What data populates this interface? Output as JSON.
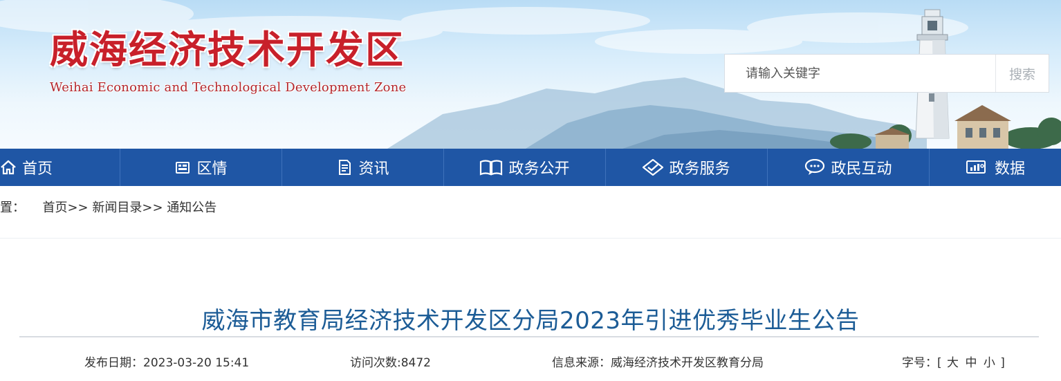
{
  "header": {
    "site_title": "威海经济技术开发区",
    "site_subtitle": "Weihai Economic and Technological Development Zone",
    "search_placeholder": "请输入关键字",
    "search_button": "搜索"
  },
  "nav": [
    {
      "label": "首页",
      "icon": "home-icon"
    },
    {
      "label": "区情",
      "icon": "building-icon"
    },
    {
      "label": "资讯",
      "icon": "document-icon"
    },
    {
      "label": "政务公开",
      "icon": "open-book-icon"
    },
    {
      "label": "政务服务",
      "icon": "service-diamond-icon"
    },
    {
      "label": "政民互动",
      "icon": "chat-bubble-icon"
    },
    {
      "label": "数据",
      "icon": "monitor-chart-icon"
    }
  ],
  "breadcrumb": {
    "prefix": "置：",
    "items": [
      "首页",
      "新闻目录",
      "通知公告"
    ],
    "separator": ">>"
  },
  "article": {
    "title": "威海市教育局经济技术开发区分局2023年引进优秀毕业生公告",
    "publish_label": "发布日期：",
    "publish_date": "2023-03-20 15:41",
    "visits_label": "访问次数:",
    "visits": "8472",
    "source_label": "信息来源：",
    "source": "威海经济技术开发区教育分局",
    "font_size_label": "字号：",
    "font_size_open": "[",
    "font_size_options": [
      "大",
      "中",
      "小"
    ],
    "font_size_close": "]"
  },
  "colors": {
    "nav_bg": "#1f56a5",
    "title_red": "#c8202a",
    "article_title": "#1c5c96"
  }
}
